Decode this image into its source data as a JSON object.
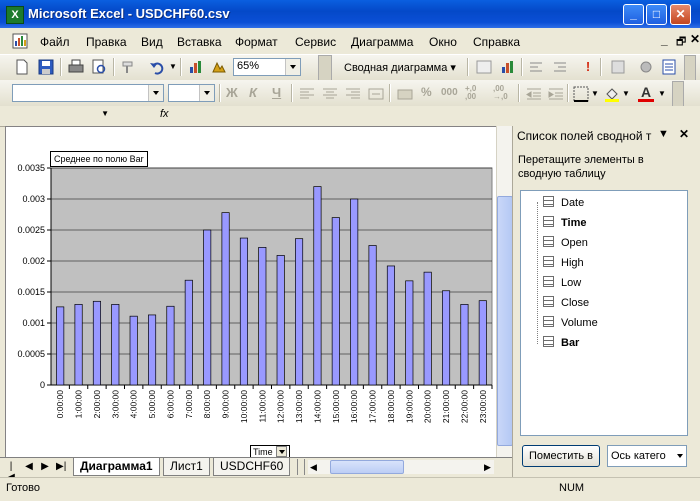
{
  "window": {
    "title": "Microsoft Excel - USDCHF60.csv",
    "app_icon": "excel-icon"
  },
  "menu": [
    "Файл",
    "Правка",
    "Вид",
    "Вставка",
    "Формат",
    "Сервис",
    "Диаграмма",
    "Окно",
    "Справка"
  ],
  "toolbar": {
    "zoom": "65%",
    "pivot_chart_label": "Сводная диаграмма",
    "bold": "Ж",
    "italic": "К",
    "underline": "Ч",
    "percent": "%",
    "thousands": "000",
    "inc_decimal": "+,0 ,00",
    "dec_decimal": ",00 →,0"
  },
  "formula_bar": {
    "fx": "fx",
    "name_box": ""
  },
  "chart": {
    "field_button": "Среднее по полю Bar",
    "axis_field_button": "Time",
    "plot_bg": "#c0c0c0",
    "bar_color": "#9999ff"
  },
  "chart_data": {
    "type": "bar",
    "categories": [
      "0:00:00",
      "1:00:00",
      "2:00:00",
      "3:00:00",
      "4:00:00",
      "5:00:00",
      "6:00:00",
      "7:00:00",
      "8:00:00",
      "9:00:00",
      "10:00:00",
      "11:00:00",
      "12:00:00",
      "13:00:00",
      "14:00:00",
      "15:00:00",
      "16:00:00",
      "17:00:00",
      "18:00:00",
      "19:00:00",
      "20:00:00",
      "21:00:00",
      "22:00:00",
      "23:00:00"
    ],
    "values": [
      0.00126,
      0.0013,
      0.00135,
      0.0013,
      0.00111,
      0.00113,
      0.00127,
      0.00169,
      0.0025,
      0.00278,
      0.00237,
      0.00222,
      0.00209,
      0.00236,
      0.0032,
      0.0027,
      0.003,
      0.00225,
      0.00192,
      0.00168,
      0.00182,
      0.00152,
      0.0013,
      0.00136
    ],
    "ylim": [
      0,
      0.0035
    ],
    "yticks": [
      "0",
      "0.0005",
      "0.001",
      "0.0015",
      "0.002",
      "0.0025",
      "0.003",
      "0.0035"
    ],
    "grid": true
  },
  "sheets": {
    "tabs": [
      "Диаграмма1",
      "Лист1",
      "USDCHF60"
    ],
    "active": "Диаграмма1"
  },
  "status": {
    "left": "Готово",
    "num": "NUM"
  },
  "task_pane": {
    "title": "Список полей сводной т",
    "description": "Перетащите элементы в сводную таблицу",
    "fields": [
      {
        "name": "Date",
        "bold": false
      },
      {
        "name": "Time",
        "bold": true
      },
      {
        "name": "Open",
        "bold": false
      },
      {
        "name": "High",
        "bold": false
      },
      {
        "name": "Low",
        "bold": false
      },
      {
        "name": "Close",
        "bold": false
      },
      {
        "name": "Volume",
        "bold": false
      },
      {
        "name": "Bar",
        "bold": true
      }
    ],
    "place_button": "Поместить в",
    "axis_select": "Ось катего"
  }
}
